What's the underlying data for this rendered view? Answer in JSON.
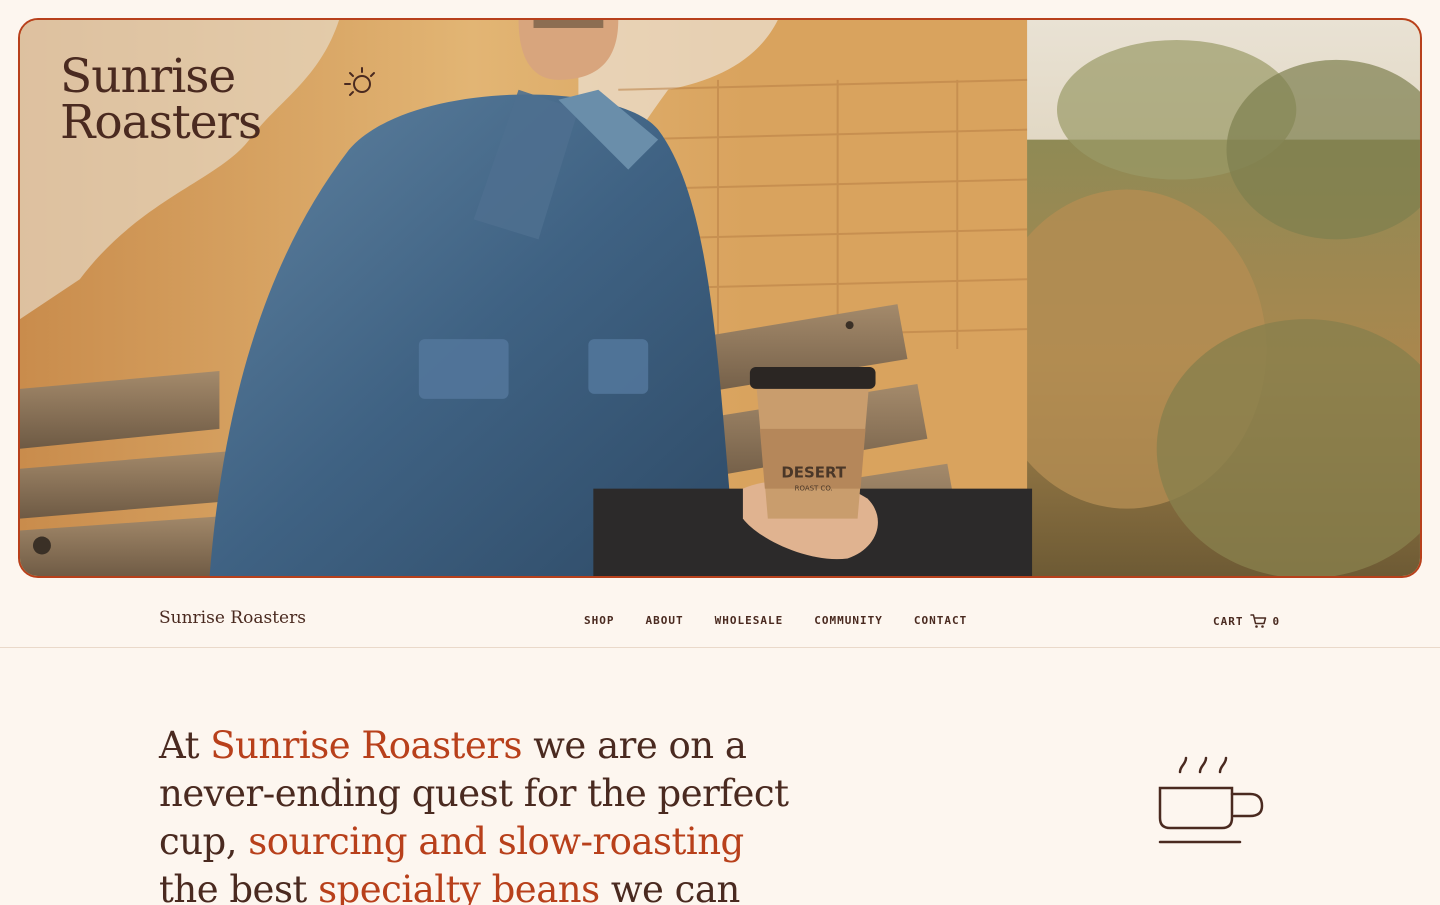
{
  "hero": {
    "brand_line1": "Sunrise",
    "brand_line2": "Roasters",
    "cup_text_main": "DESERT",
    "cup_text_sub": "ROAST CO."
  },
  "nav": {
    "logo": "Sunrise Roasters",
    "links": [
      "SHOP",
      "ABOUT",
      "WHOLESALE",
      "COMMUNITY",
      "CONTACT"
    ],
    "cart_label": "CART",
    "cart_count": "0"
  },
  "intro": {
    "p1": "At ",
    "p2": "Sunrise Roasters",
    "p3": " we are on a never-ending quest for the perfect cup, ",
    "p4": "sourcing and slow-roasting",
    "p5": " the best ",
    "p6": "specialty beans",
    "p7": " we can"
  },
  "colors": {
    "accent": "#b8401b",
    "text": "#4a2a20",
    "background": "#fdf6ef"
  }
}
